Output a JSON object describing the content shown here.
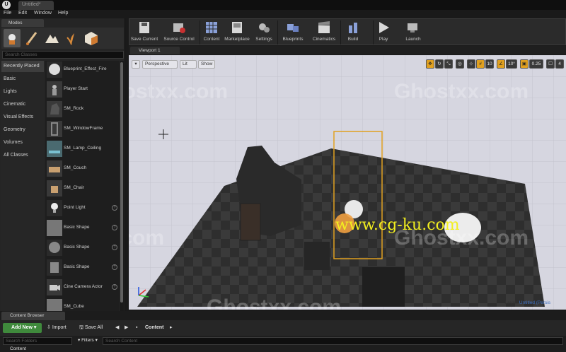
{
  "window": {
    "tab_title": "Untitled*"
  },
  "menu": {
    "items": [
      "File",
      "Edit",
      "Window",
      "Help"
    ]
  },
  "modes": {
    "tab_label": "Modes",
    "search_placeholder": "Search Classes",
    "categories": [
      "Recently Placed",
      "Basic",
      "Lights",
      "Cinematic",
      "Visual Effects",
      "Geometry",
      "Volumes",
      "All Classes"
    ],
    "active_category": "Recently Placed",
    "items": [
      "Blueprint_Effect_Fire",
      "Player Start",
      "SM_Rock",
      "SM_WindowFrame",
      "SM_Lamp_Ceiling",
      "SM_Couch",
      "SM_Chair",
      "Point Light",
      "Basic Shape",
      "Basic Shape",
      "Basic Shape",
      "Cine Camera Actor",
      "SM_Cube"
    ]
  },
  "toolbar": {
    "buttons": [
      "Save Current",
      "Source Control",
      "Content",
      "Marketplace",
      "Settings",
      "Blueprints",
      "Cinematics",
      "Build",
      "Play",
      "Launch"
    ]
  },
  "viewport": {
    "tab_label": "Viewport 1",
    "perspective_label": "Perspective",
    "lit_label": "Lit",
    "show_label": "Show",
    "grid_snap": "10",
    "rotation_snap": "10°",
    "scale_snap": "0.25",
    "camera_speed": "4",
    "level_label": "Level:",
    "level_name": "Untitled (Persis"
  },
  "watermarks": [
    "Ghostxx.com",
    "Ghostxx.com",
    "Ghostxx.com",
    "Ghostxx.com",
    "Ghostxx.com",
    "Ghostxx.com",
    "Ghostxx.com"
  ],
  "overlay_text": "www.cg-ku.com",
  "content_browser": {
    "tab_label": "Content Browser",
    "add_new_label": "Add New",
    "import_label": "Import",
    "save_all_label": "Save All",
    "path_root": "Content",
    "search_folders_placeholder": "Search Folders",
    "filters_label": "Filters",
    "search_content_placeholder": "Search Content",
    "folder_item": "Content"
  },
  "colors": {
    "add_new_green": "#3f8a3c",
    "viewport_bg": "#d6d6e0",
    "selection_orange": "#e0a020",
    "overlay_yellow": "#f2ef1f"
  }
}
